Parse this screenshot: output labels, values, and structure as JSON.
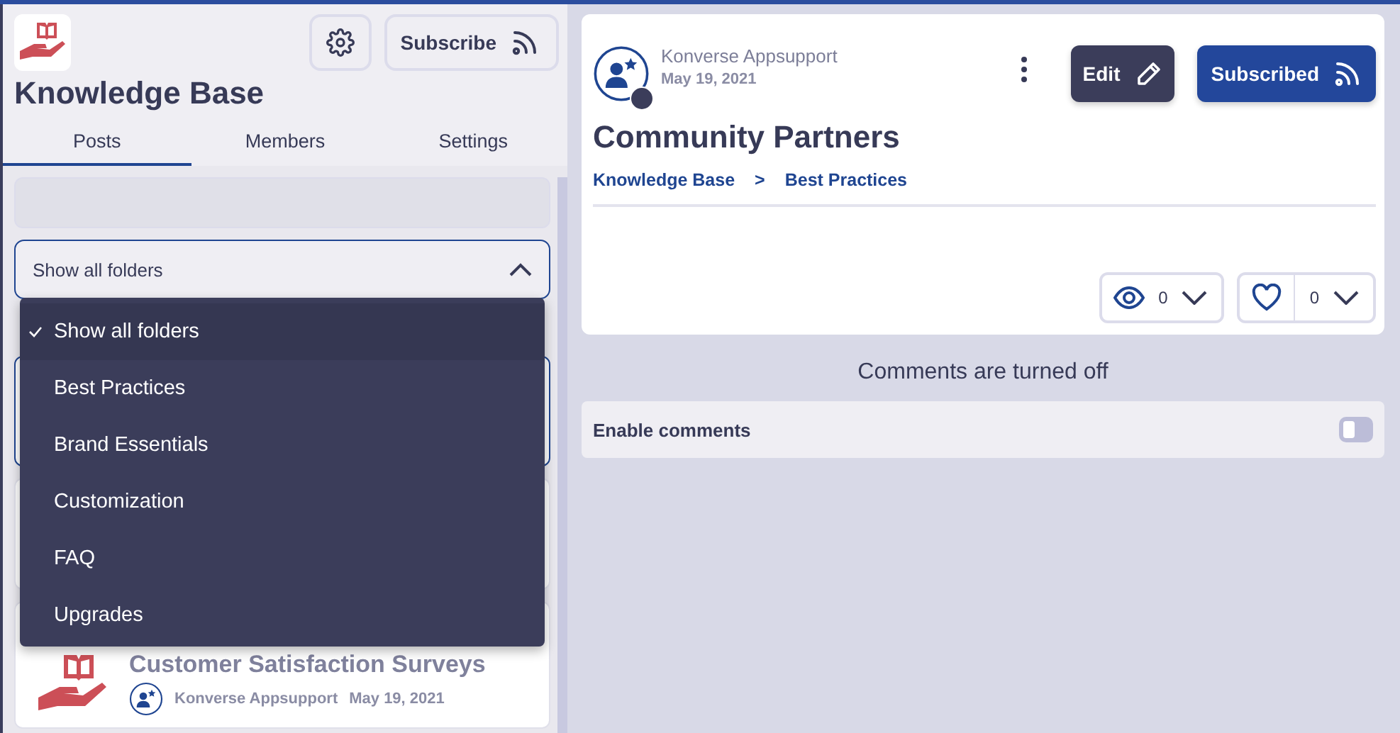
{
  "space": {
    "title": "Knowledge Base",
    "subscribe_label": "Subscribe"
  },
  "tabs": [
    {
      "label": "Posts",
      "selected": true
    },
    {
      "label": "Members",
      "selected": false
    },
    {
      "label": "Settings",
      "selected": false
    }
  ],
  "folder_filter": {
    "value": "Show all folders",
    "expanded": true,
    "options": [
      {
        "label": "Show all folders",
        "selected": true
      },
      {
        "label": "Best Practices",
        "selected": false
      },
      {
        "label": "Brand Essentials",
        "selected": false
      },
      {
        "label": "Customization",
        "selected": false
      },
      {
        "label": "FAQ",
        "selected": false
      },
      {
        "label": "Upgrades",
        "selected": false
      }
    ]
  },
  "posts": [
    {
      "selected": true
    },
    {
      "selected": false
    },
    {
      "selected": false,
      "title": "Customer Satisfaction Surveys",
      "author": "Konverse Appsupport",
      "date": "May 19, 2021"
    }
  ],
  "post": {
    "author": "Konverse Appsupport",
    "date": "May 19, 2021",
    "title": "Community Partners",
    "breadcrumb": [
      "Knowledge Base",
      "Best Practices"
    ],
    "breadcrumb_separator": ">",
    "edit_label": "Edit",
    "subscribed_label": "Subscribed",
    "views": "0",
    "likes": "0"
  },
  "comments": {
    "notice": "Comments are turned off",
    "toggle_label": "Enable comments",
    "on": false
  }
}
